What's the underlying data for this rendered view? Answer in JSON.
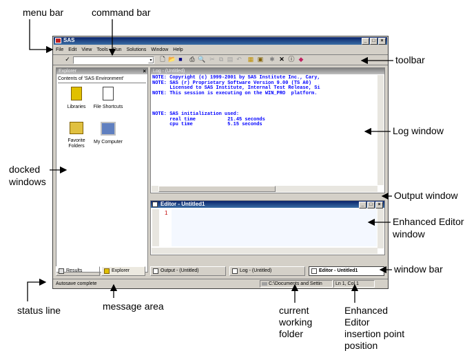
{
  "callouts": {
    "menu_bar": "menu bar",
    "command_bar": "command bar",
    "toolbar": "toolbar",
    "log_window": "Log window",
    "docked_windows": [
      "docked",
      "windows"
    ],
    "output_window": "Output window",
    "enhanced_editor_window": [
      "Enhanced Editor",
      "window"
    ],
    "window_bar": "window bar",
    "status_line": "status line",
    "message_area": "message area",
    "current_working_folder": [
      "current",
      "working",
      "folder"
    ],
    "insertion_point": [
      "Enhanced",
      "Editor",
      "insertion point",
      "position"
    ]
  },
  "app": {
    "title": "SAS",
    "menu": [
      "File",
      "Edit",
      "View",
      "Tools",
      "Run",
      "Solutions",
      "Window",
      "Help"
    ]
  },
  "explorer": {
    "title": "Explorer",
    "contents_label": "Contents of 'SAS Environment'",
    "icons": [
      {
        "label": "Libraries",
        "icon": "library-icon"
      },
      {
        "label": "File Shortcuts",
        "icon": "file-shortcuts-icon"
      },
      {
        "label": "Favorite Folders",
        "icon": "favorite-folders-icon"
      },
      {
        "label": "My Computer",
        "icon": "my-computer-icon"
      }
    ],
    "tabs": [
      "Results",
      "Explorer"
    ]
  },
  "log": {
    "title": "Log - (Untitled)",
    "lines": [
      "NOTE: Copyright (c) 1999-2001 by SAS Institute Inc., Cary,",
      "NOTE: SAS (r) Proprietary Software Version 9.00 (TS A0)",
      "      Licensed to SAS Institute, Internal Test Release, Si",
      "NOTE: This session is executing on the WIN_PRO  platform.",
      "",
      "",
      "",
      "NOTE: SAS initialization used:",
      "      real time           21.45 seconds",
      "      cpu time            5.15 seconds"
    ]
  },
  "editor": {
    "title": "Editor - Untitled1",
    "line_number": "1"
  },
  "window_bar": {
    "tabs": [
      "Output - (Untitled)",
      "Log - (Untitled)",
      "Editor - Untitled1"
    ]
  },
  "status": {
    "message": "Autosave complete",
    "folder": "C:\\Documents and Settin",
    "position": "Ln 1, Col 1"
  },
  "colors": {
    "title_active": "#0a246a",
    "title_inactive": "#808080",
    "log_text": "#0000ff",
    "window_face": "#d4d0c8"
  }
}
